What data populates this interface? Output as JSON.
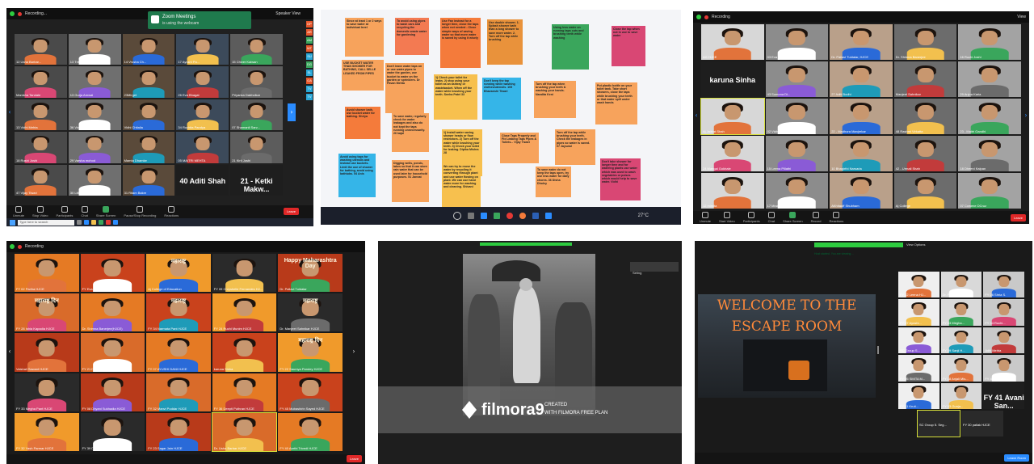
{
  "panels": {
    "p1": {
      "recording_label": "Recording...",
      "notice_title": "Zoom Meetings",
      "notice_sub": "is using the webcam",
      "speaker_view": "Speaker View",
      "tiles": [
        "12 Usha Barbar...",
        "13 Trisha Dhaval",
        "14 Vrusha Ch...",
        "17 Ayushi Pa...",
        "15 Chiver Kaiwan",
        "Manisha Tandale",
        "13 Gurja Arnwal",
        "23Mirget",
        "26 Eva Bhagat",
        "Priyanka Dabholkar",
        "13 Vidhi Mehta",
        "36 Vidhi Rander",
        "Vidhi Chitalia",
        "34 Ruchita Pandya",
        "07 Shamanli Sarv...",
        "18 Rushi Joshi",
        "29 Varsha mohod",
        "Mamta Dhamke",
        "05 MAITRI MEHTA",
        "21 Kirti Joshi",
        "47 Vijay Tiwari",
        "30 Lithika P0OL",
        "31 Ritam Bakre",
        "40 Aditi Shah",
        "21 - Ketki Makw..."
      ],
      "controls": [
        "Unmute",
        "Stop Video",
        "Participants",
        "Chat",
        "Share Screen",
        "Pause/Stop Recording",
        "Reactions"
      ],
      "participants_count": "79",
      "leave": "Leave",
      "search_placeholder": "Type here to search",
      "side_badges": [
        "DP",
        "AR",
        "AM",
        "MT",
        "SU",
        "DG",
        "SL",
        "GA",
        "TV",
        "TV"
      ]
    },
    "p2": {
      "notes": [
        {
          "text": "Since at least 1 or 2 ways to save water at individual level",
          "color": "#f7a35c"
        },
        {
          "text": "To avoid using pipes to wash cars and recycling the domestic waste water for gardening",
          "color": "#f37a52"
        },
        {
          "text": "Use Fan instead for a longer time, close the taps when not needed - Close simple ways of saving water so that more water is saved by using it wisely",
          "color": "#f47b3b"
        },
        {
          "text": "Use double shower. 1. Splash shower bath than a long shower to save more water. 2. Turn off the tap while brushing",
          "color": "#e9923b"
        },
        {
          "text": "Using less water on running taps cuts and brushing teeth while washing",
          "color": "#3aa65c"
        },
        {
          "text": "Close the tap when not in use to save water",
          "color": "#d94774"
        },
        {
          "text": "USE BUCKET WATER THAN SHOWER FOR BATHING, CALL SELLE LEAKED FROM PIPES",
          "color": "#f7a35c"
        },
        {
          "text": "Don't leave water taps on or use water pipes to water the garden, use bucket to water on the garden or sprinklers. Dr Pavan Mehta",
          "color": "#f7a35c"
        },
        {
          "text": "1) Check your toilet for leaks. 2) stop using your toilet as an ashtray or wastebasket. When off the water while brushing your teeth. Sneha Patel 33",
          "color": "#f7c04e"
        },
        {
          "text": "Don't keep the tap running while washing clothes/utensils. 105 Bhavanshi Tiwari",
          "color": "#35b5e8"
        },
        {
          "text": "Turn off the tap when brushing your teeth & washing your hands. Nandita Keni",
          "color": "#f7a35c"
        },
        {
          "text": "Put plastic bottle on your toilet tank. Take short showers, close the taps while brushing your teeth or that water spill under wash hands",
          "color": "#f7a35c"
        },
        {
          "text": "Avoid shower bath, use bucket water for bathing. Shriya",
          "color": "#f47b3b"
        },
        {
          "text": "To save water, regularly check for water leakages and also do not kept the taps running unnecessarily. 26 kajal",
          "color": "#f7a35c"
        },
        {
          "text": "1) Install water saving shower heads or flow restrictors. 2) Turn off the water while brushing your teeth. 3) Check your toilet for leaking. Dipika Mishra 28",
          "color": "#f7c04e"
        },
        {
          "text": "Close Taps Properly and Fix Leaking Taps Pipes & Toilets... Vijay Tiwari",
          "color": "#f7a35c"
        },
        {
          "text": "Turn off the tap while brushing your teeth. Check the leakages in pipes so water is saved. 07 Jayswal",
          "color": "#f7a35c"
        },
        {
          "text": "Avoid using taps for washing utensils and instead use buckets. Limit the use of shower for bathing, avoid using bathtubs. 54 Anis",
          "color": "#35b5e8"
        },
        {
          "text": "Digging wells, ponds, lakes so that it can store rain water that can be used later for household purposes. 51 Jannat",
          "color": "#f7a35c"
        },
        {
          "text": "We can try to reuse the water by recycling it converting through plant and use water flowing on plant. We can use hand water more for washing and cleaning. Shivani",
          "color": "#f7c04e"
        },
        {
          "text": "To save water do not keep the taps open, try use less water for daily chores. 36 Disha Dholey",
          "color": "#f7a35c"
        },
        {
          "text": "Don't take shower for longer time and for watering plants use water which was used to wash vegetables or pulses which would help to save water. Vidhi",
          "color": "#d94774"
        }
      ],
      "clock": "27°C"
    },
    "p3": {
      "recording_label": "Recording",
      "view": "View",
      "tiles": [
        "AG HJCE",
        "03 Eva Bhagat",
        "Dr. Pallavi Tuldalar, HJCE",
        "Dr. Shimna Banerjee",
        "16 Ruchi Joshi",
        "karuna Sinha",
        "43 Sumona Di...",
        "27 Aditi Bodhi",
        "Manjeet Sahnikar",
        "29 Anjna Karia",
        "Aj Jaiblat Shah",
        "02 Vidhi Mehta",
        "22 - Madhura Manjrekar",
        "48 Rashmi Virkatta",
        "23 - Maitri Gandhi",
        "24 Mangal Gokhale",
        "15 Leena Pillathi",
        "10 Bhagirthi Narsaria",
        "42 - Urmali Shah",
        "18 Dheeni Kalpan",
        "12 mimita",
        "17 Mrunmayi",
        "AKhitauff Shubham",
        "Aj College",
        "07 Cowene DCruz"
      ],
      "controls": [
        "Unmute",
        "Start Video",
        "Participants",
        "Chat",
        "Share Screen",
        "Record",
        "Reactions"
      ],
      "participants_count": "41",
      "leave": "Leave"
    },
    "p4": {
      "recording_label": "Recording",
      "tiles": [
        "FY 02 Pariha HJCE",
        "FY Eva Bhagat HJCE",
        "Aj College of Education",
        "FY 09 Chryshelle Fernandes HJ...",
        "Dr. Pallavi Tuldalar",
        "FY 28 Ishia Kapadia HJCE",
        "Dr. Shimna Banerjee(HJCE)",
        "FY 34 Narmata Pant HJCE",
        "FY 24 Ruchi Munim HJCE",
        "Dr. Manjeet Sahnikar HJCE",
        "Vaishali Sawant HJCE",
        "FY 21 Disha Mehta HJCE",
        "FY 07 AYUSHI DANI HJCE",
        "karuna Sinha",
        "FY 22 Saumya Pandey HJCE",
        "FY 33 Megha Pant HJCE",
        "FY 08 Dhyani Sukhadia HJCE",
        "FY 32 Manvi Poddar HJCE",
        "FY 36 Deepti Puthran HJCE",
        "FY 45 Mubashirin Sayed HJCE",
        "FY 32 Yash Parmar HJCE",
        "FY 39 Disha Jain HJCE",
        "FY 23 Sagar Jain HJCE",
        "Dr. Usha Barbar HJCE",
        "FY 40 Aarthi Trivedi HJCE"
      ],
      "banners": [
        "महाराष्ट्र",
        "Happy Maharashtra Day",
        "महाराष्ट्र दिन",
        "महाराष्ट्र",
        "महाराष्ट्र",
        "महाराष्ट्र दिन"
      ],
      "leave": "Leave"
    },
    "p5": {
      "watermark_main": "filmora9",
      "watermark_created": "CREATED",
      "watermark_plan": "WITH FILMORA FREE PLAN",
      "side_label": "Seting"
    },
    "p6": {
      "header_text": "Host started. You are viewing ...",
      "view_options": "View Options",
      "welcome_line1": "WELCOME TO THE",
      "welcome_line2": "ESCAPE ROOM",
      "tiles": [
        "FY 12 Leena HJ...",
        "Dr. Pallavi Tuldali...",
        "FY 06 Shria S.",
        "FY 07 Ayushi...",
        "FY 33 Megha...",
        "FY 34 Ruchi...",
        "SC Group S...",
        "FY 39 Sanji H...",
        "Aditi Mehta",
        "FY 05 SMITA M...",
        "FY 18 Anjali Mis...",
        "FY 40 Shweta...",
        "FY 11 Kruti...",
        "FY 03 Gunja...",
        "FY 41 Avani San...",
        "SC GROUP 5 ...",
        "SC Group 5. Seg...",
        "FY 30 pallak HJCE"
      ],
      "leave": "Leave Room"
    }
  },
  "colors": {
    "zoom_bg": "#1a1a1a",
    "leave_red": "#e02828",
    "active_border": "#d6e03a",
    "escape_title": "#ff8a3a"
  }
}
